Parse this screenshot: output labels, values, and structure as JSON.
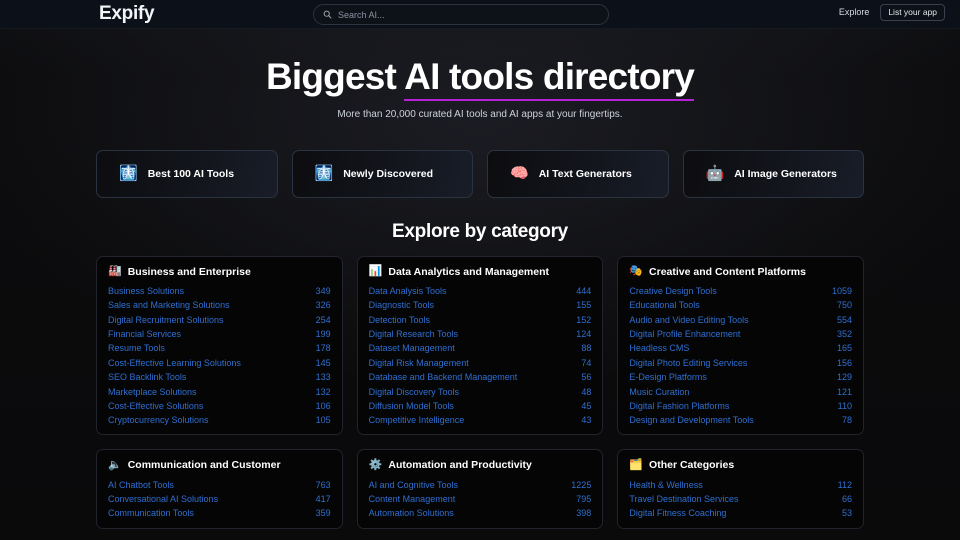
{
  "header": {
    "logo": "Expify",
    "search": {
      "placeholder": "Search AI...",
      "value": ""
    },
    "explore_label": "Explore",
    "list_app_label": "List your app"
  },
  "hero": {
    "title_lead": "Biggest ",
    "title_underlined": "AI tools directory",
    "subtitle": "More than 20,000 curated AI tools and AI apps at your fingertips.",
    "accent_color": "#b622d6"
  },
  "features": [
    {
      "icon": "🧠",
      "emoji": "🩻",
      "label": "Best 100 AI Tools",
      "icon_name": "ai-chip-icon"
    },
    {
      "icon": "✨",
      "emoji": "🩻",
      "label": "Newly Discovered",
      "icon_name": "ai-chip-icon"
    },
    {
      "icon": "🧩",
      "emoji": "🧠",
      "label": "AI Text Generators",
      "icon_name": "brain-gear-icon"
    },
    {
      "icon": "🤖",
      "emoji": "🤖",
      "label": "AI Image Generators",
      "icon_name": "robot-icon"
    }
  ],
  "section": {
    "title": "Explore by category"
  },
  "link_color": "#2f6fd0",
  "categories": [
    {
      "icon": "🏭",
      "icon_name": "factory-icon",
      "title": "Business and Enterprise",
      "items": [
        {
          "name": "Business Solutions",
          "count": "349"
        },
        {
          "name": "Sales and Marketing Solutions",
          "count": "326"
        },
        {
          "name": "Digital Recruitment Solutions",
          "count": "254"
        },
        {
          "name": "Financial Services",
          "count": "199"
        },
        {
          "name": "Resume Tools",
          "count": "178"
        },
        {
          "name": "Cost-Effective Learning Solutions",
          "count": "145"
        },
        {
          "name": "SEO Backlink Tools",
          "count": "133"
        },
        {
          "name": "Marketplace Solutions",
          "count": "132"
        },
        {
          "name": "Cost-Effective Solutions",
          "count": "106"
        },
        {
          "name": "Cryptocurrency Solutions",
          "count": "105"
        }
      ]
    },
    {
      "icon": "📊",
      "icon_name": "chart-monitor-icon",
      "title": "Data Analytics and Management",
      "items": [
        {
          "name": "Data Analysis Tools",
          "count": "444"
        },
        {
          "name": "Diagnostic Tools",
          "count": "155"
        },
        {
          "name": "Detection Tools",
          "count": "152"
        },
        {
          "name": "Digital Research Tools",
          "count": "124"
        },
        {
          "name": "Dataset Management",
          "count": "88"
        },
        {
          "name": "Digital Risk Management",
          "count": "74"
        },
        {
          "name": "Database and Backend Management",
          "count": "56"
        },
        {
          "name": "Digital Discovery Tools",
          "count": "48"
        },
        {
          "name": "Diffusion Model Tools",
          "count": "45"
        },
        {
          "name": "Competitive Intelligence",
          "count": "43"
        }
      ]
    },
    {
      "icon": "🎭",
      "icon_name": "theater-masks-icon",
      "title": "Creative and Content Platforms",
      "items": [
        {
          "name": "Creative Design Tools",
          "count": "1059"
        },
        {
          "name": "Educational Tools",
          "count": "750"
        },
        {
          "name": "Audio and Video Editing Tools",
          "count": "554"
        },
        {
          "name": "Digital Profile Enhancement",
          "count": "352"
        },
        {
          "name": "Headless CMS",
          "count": "165"
        },
        {
          "name": "Digital Photo Editing Services",
          "count": "156"
        },
        {
          "name": "E-Design Platforms",
          "count": "129"
        },
        {
          "name": "Music Curation",
          "count": "121"
        },
        {
          "name": "Digital Fashion Platforms",
          "count": "110"
        },
        {
          "name": "Design and Development Tools",
          "count": "78"
        }
      ]
    },
    {
      "icon": "🔈",
      "icon_name": "chat-bubble-icon",
      "title": "Communication and Customer",
      "items": [
        {
          "name": "AI Chatbot Tools",
          "count": "763"
        },
        {
          "name": "Conversational AI Solutions",
          "count": "417"
        },
        {
          "name": "Communication Tools",
          "count": "359"
        }
      ]
    },
    {
      "icon": "⚙️",
      "icon_name": "automation-nodes-icon",
      "title": "Automation and Productivity",
      "items": [
        {
          "name": "AI and Cognitive Tools",
          "count": "1225"
        },
        {
          "name": "Content Management",
          "count": "795"
        },
        {
          "name": "Automation Solutions",
          "count": "398"
        }
      ]
    },
    {
      "icon": "🗂️",
      "icon_name": "folder-icon",
      "title": "Other Categories",
      "items": [
        {
          "name": "Health & Wellness",
          "count": "112"
        },
        {
          "name": "Travel Destination Services",
          "count": "66"
        },
        {
          "name": "Digital Fitness Coaching",
          "count": "53"
        }
      ]
    }
  ]
}
